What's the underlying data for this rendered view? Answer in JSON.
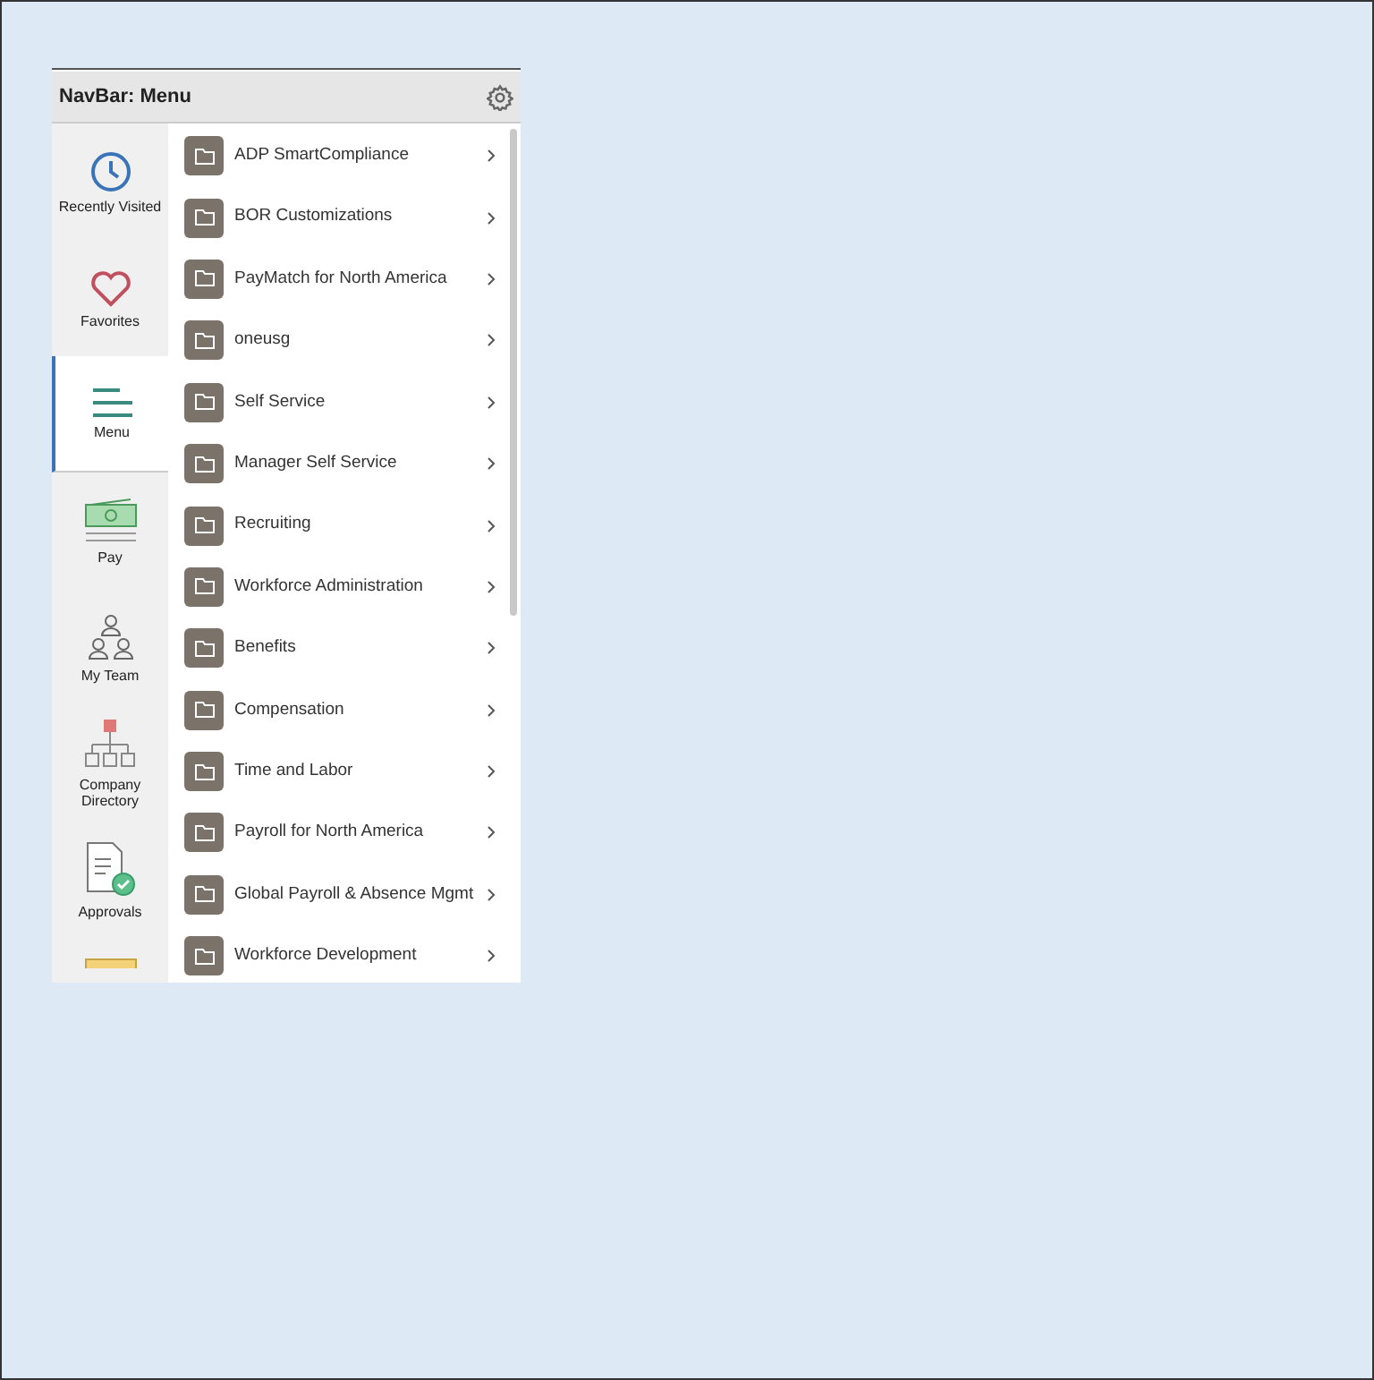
{
  "header": {
    "title": "NavBar: Menu"
  },
  "sidebar": {
    "items": [
      {
        "kind": "clock",
        "label": "Recently Visited",
        "selected": false
      },
      {
        "kind": "heart",
        "label": "Favorites",
        "selected": false
      },
      {
        "kind": "menu",
        "label": "Menu",
        "selected": true
      },
      {
        "kind": "pay",
        "label": "Pay",
        "selected": false
      },
      {
        "kind": "team",
        "label": "My Team",
        "selected": false
      },
      {
        "kind": "org",
        "label": "Company Directory",
        "selected": false
      },
      {
        "kind": "approvals",
        "label": "Approvals",
        "selected": false
      },
      {
        "kind": "note",
        "selected": false
      }
    ]
  },
  "menu": {
    "items": [
      {
        "label": "ADP SmartCompliance"
      },
      {
        "label": "BOR Customizations"
      },
      {
        "label": "PayMatch for North America"
      },
      {
        "label": "oneusg"
      },
      {
        "label": "Self Service"
      },
      {
        "label": "Manager Self Service"
      },
      {
        "label": "Recruiting"
      },
      {
        "label": "Workforce Administration"
      },
      {
        "label": "Benefits"
      },
      {
        "label": "Compensation"
      },
      {
        "label": "Time and Labor"
      },
      {
        "label": "Payroll for North America"
      },
      {
        "label": "Global Payroll & Absence Mgmt"
      },
      {
        "label": "Workforce Development"
      }
    ]
  }
}
